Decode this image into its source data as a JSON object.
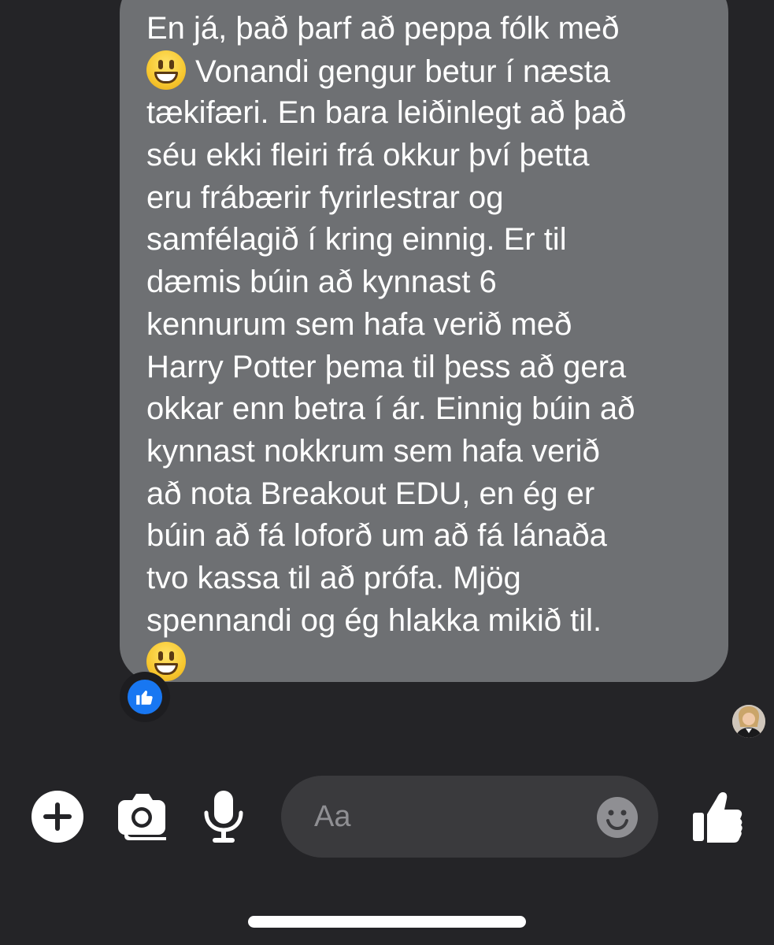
{
  "message": {
    "lines": [
      "En já, það þarf að peppa fólk með",
      "Vonandi gengur betur í næsta",
      "tækifæri. En bara leiðinlegt að það",
      "séu ekki fleiri frá okkur því þetta",
      "eru frábærir fyrirlestrar og",
      "samfélagið í kring einnig. Er til",
      "dæmis búin að kynnast 6",
      "kennurum sem hafa verið með",
      "Harry Potter þema til þess að gera",
      "okkar enn betra í ár. Einnig búin að",
      "kynnast nokkrum sem hafa verið",
      "að nota Breakout EDU, en ég er",
      "búin að fá loforð um að fá lánaða",
      "tvo kassa til að prófa. Mjög",
      "spennandi og ég hlakka mikið til."
    ],
    "emoji": "grinning-face",
    "bubble_color": "#6e7073",
    "reaction": "like"
  },
  "colors": {
    "background": "#242427",
    "composer_background": "#3a3a3d",
    "reaction_blue": "#1877f2",
    "icon_color": "#ffffff"
  },
  "composer": {
    "placeholder": "Aa"
  },
  "toolbar": {
    "icons": [
      "plus-icon",
      "camera-icon",
      "microphone-icon",
      "emoji-icon",
      "thumbs-up-icon"
    ]
  }
}
